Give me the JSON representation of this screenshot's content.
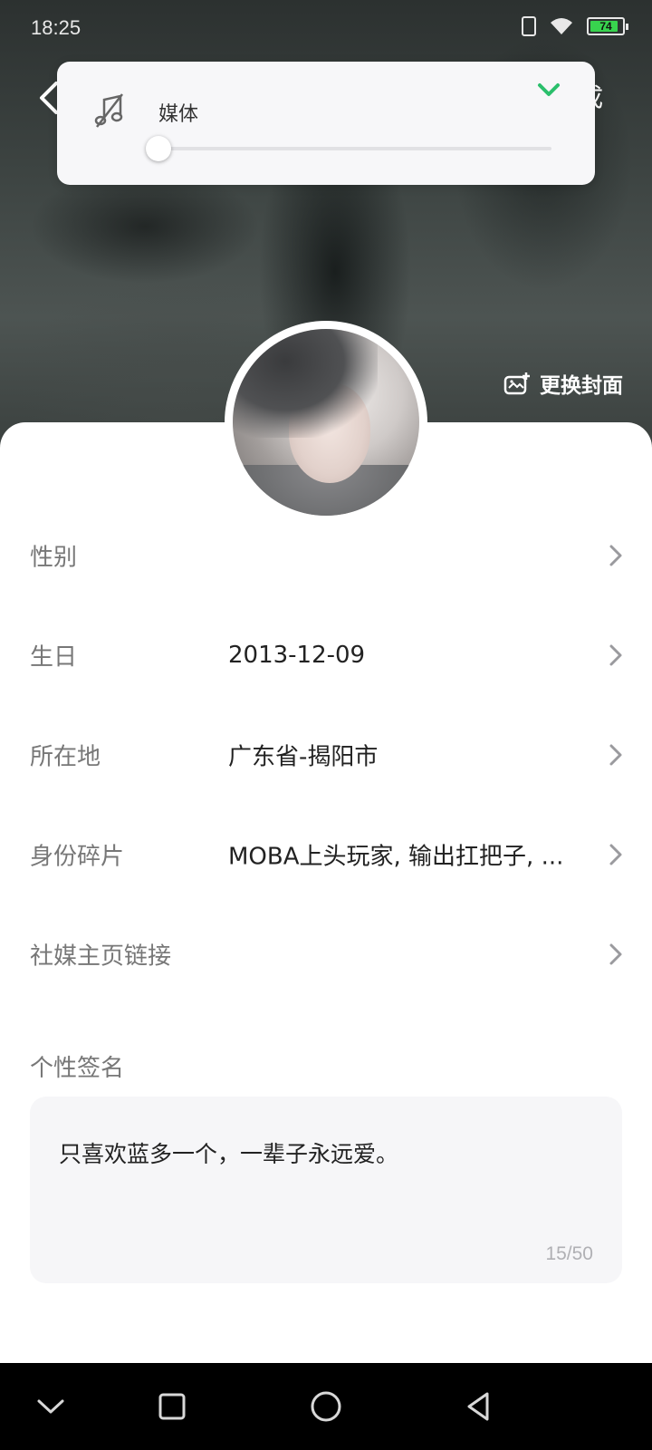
{
  "status_bar": {
    "time": "18:25",
    "battery_level": "74",
    "icons": [
      "vibrate-icon",
      "wifi-icon",
      "battery-icon"
    ]
  },
  "header": {
    "done_label": "完成"
  },
  "volume_popup": {
    "label": "媒体",
    "icon": "music-off-icon",
    "level": 0
  },
  "cover": {
    "change_cover_label": "更换封面"
  },
  "profile_rows": [
    {
      "label": "性别",
      "value": ""
    },
    {
      "label": "生日",
      "value": "2013-12-09"
    },
    {
      "label": "所在地",
      "value": "广东省-揭阳市"
    },
    {
      "label": "身份碎片",
      "value": "MOBA上头玩家, 输出扛把子, ..."
    },
    {
      "label": "社媒主页链接",
      "value": ""
    }
  ],
  "signature": {
    "label": "个性签名",
    "text": "只喜欢蓝多一个，一辈子永远爱。",
    "count": "15/50"
  },
  "colors": {
    "accent_green": "#2bbf6c",
    "battery_green": "#38d34e"
  }
}
